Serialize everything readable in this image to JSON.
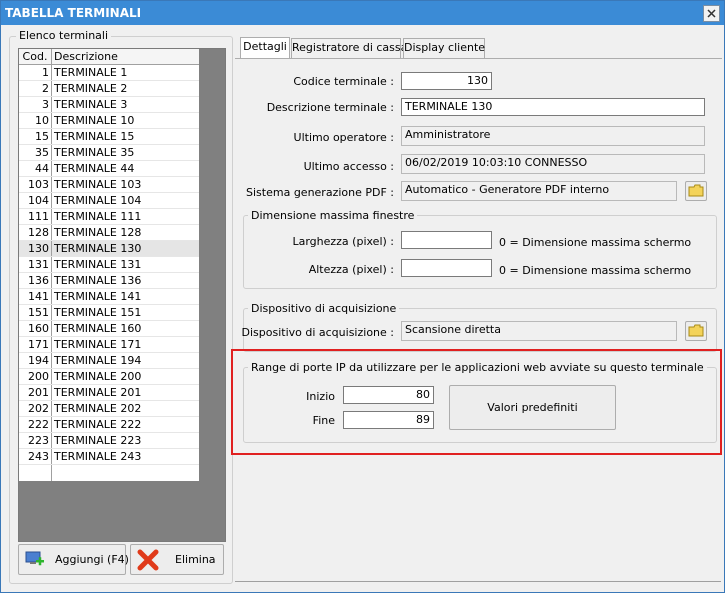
{
  "window": {
    "title": "TABELLA TERMINALI"
  },
  "left": {
    "group_label": "Elenco terminali",
    "columns": {
      "code": "Cod.",
      "desc": "Descrizione"
    },
    "rows": [
      {
        "code": "1",
        "desc": "TERMINALE 1"
      },
      {
        "code": "2",
        "desc": "TERMINALE 2"
      },
      {
        "code": "3",
        "desc": "TERMINALE 3"
      },
      {
        "code": "10",
        "desc": "TERMINALE 10"
      },
      {
        "code": "15",
        "desc": "TERMINALE 15"
      },
      {
        "code": "35",
        "desc": "TERMINALE 35"
      },
      {
        "code": "44",
        "desc": "TERMINALE 44"
      },
      {
        "code": "103",
        "desc": "TERMINALE 103"
      },
      {
        "code": "104",
        "desc": "TERMINALE 104"
      },
      {
        "code": "111",
        "desc": "TERMINALE 111"
      },
      {
        "code": "128",
        "desc": "TERMINALE 128"
      },
      {
        "code": "130",
        "desc": "TERMINALE 130"
      },
      {
        "code": "131",
        "desc": "TERMINALE 131"
      },
      {
        "code": "136",
        "desc": "TERMINALE 136"
      },
      {
        "code": "141",
        "desc": "TERMINALE 141"
      },
      {
        "code": "151",
        "desc": "TERMINALE 151"
      },
      {
        "code": "160",
        "desc": "TERMINALE 160"
      },
      {
        "code": "171",
        "desc": "TERMINALE 171"
      },
      {
        "code": "194",
        "desc": "TERMINALE 194"
      },
      {
        "code": "200",
        "desc": "TERMINALE 200"
      },
      {
        "code": "201",
        "desc": "TERMINALE 201"
      },
      {
        "code": "202",
        "desc": "TERMINALE 202"
      },
      {
        "code": "222",
        "desc": "TERMINALE 222"
      },
      {
        "code": "223",
        "desc": "TERMINALE 223"
      },
      {
        "code": "243",
        "desc": "TERMINALE 243"
      }
    ],
    "selected_code": "130",
    "add_button": "Aggiungi (F4)",
    "delete_button": "Elimina"
  },
  "tabs": [
    "Dettagli",
    "Registratore di cassa",
    "Display cliente"
  ],
  "details": {
    "codice_label": "Codice terminale :",
    "codice_value": "130",
    "descrizione_label": "Descrizione terminale :",
    "descrizione_value": "TERMINALE 130",
    "operatore_label": "Ultimo operatore :",
    "operatore_value": "Amministratore",
    "accesso_label": "Ultimo accesso :",
    "accesso_value": "06/02/2019  10:03:10  CONNESSO",
    "pdf_label": "Sistema generazione PDF :",
    "pdf_value": "Automatico - Generatore PDF interno"
  },
  "dimensione": {
    "group_label": "Dimensione massima finestre",
    "larghezza_label": "Larghezza (pixel) :",
    "larghezza_value": "",
    "altezza_label": "Altezza (pixel) :",
    "altezza_value": "",
    "hint": "0 = Dimensione massima schermo"
  },
  "acquisizione": {
    "group_label": "Dispositivo di acquisizione",
    "label": "Dispositivo di acquisizione :",
    "value": "Scansione diretta"
  },
  "porte": {
    "group_label": "Range di porte IP da utilizzare per le applicazioni web avviate su questo terminale",
    "inizio_label": "Inizio",
    "inizio_value": "80",
    "fine_label": "Fine",
    "fine_value": "89",
    "default_button": "Valori predefiniti"
  }
}
